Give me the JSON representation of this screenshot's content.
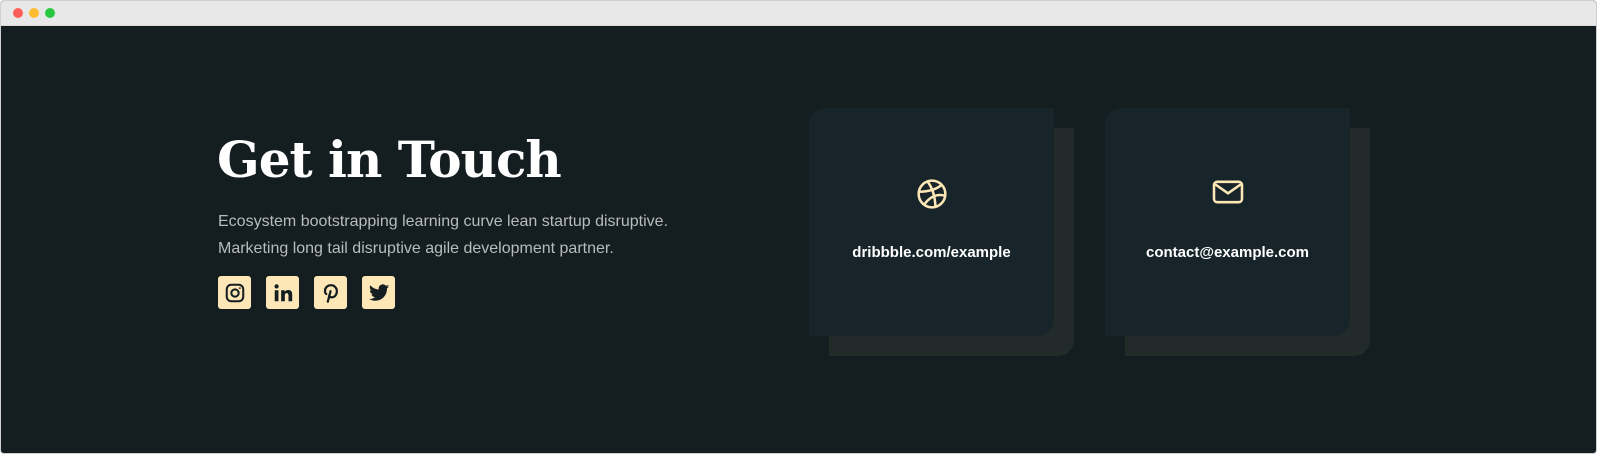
{
  "window": {
    "controls": [
      "close",
      "minimize",
      "maximize"
    ]
  },
  "colors": {
    "background": "#141d20",
    "card": "#17252a",
    "card_shadow": "#232b2a",
    "accent": "#fde7b7",
    "heading": "#ffffff",
    "body_text": "#b8bcbc"
  },
  "contact": {
    "title": "Get in Touch",
    "description": "Ecosystem bootstrapping learning curve lean startup disruptive. Marketing long tail disruptive agile development partner.",
    "socials": [
      {
        "icon": "instagram-icon"
      },
      {
        "icon": "linkedin-icon"
      },
      {
        "icon": "pinterest-icon"
      },
      {
        "icon": "twitter-icon"
      }
    ],
    "cards": [
      {
        "icon": "dribbble-icon",
        "text": "dribbble.com/example"
      },
      {
        "icon": "mail-icon",
        "text": "contact@example.com"
      }
    ]
  }
}
